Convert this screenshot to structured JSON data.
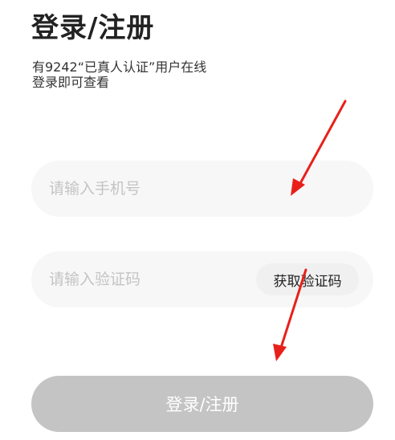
{
  "page": {
    "title": "登录/注册",
    "subtitle_line1": "有9242“已真人认证”用户在线",
    "subtitle_line2": "登录即可查看"
  },
  "form": {
    "phone_placeholder": "请输入手机号",
    "phone_value": "",
    "code_placeholder": "请输入验证码",
    "code_value": "",
    "get_code_label": "获取验证码",
    "submit_label": "登录/注册"
  },
  "colors": {
    "field_background": "#f7f7f7",
    "submit_disabled": "#c4c4c4",
    "annotation_arrow": "#e8201a"
  }
}
